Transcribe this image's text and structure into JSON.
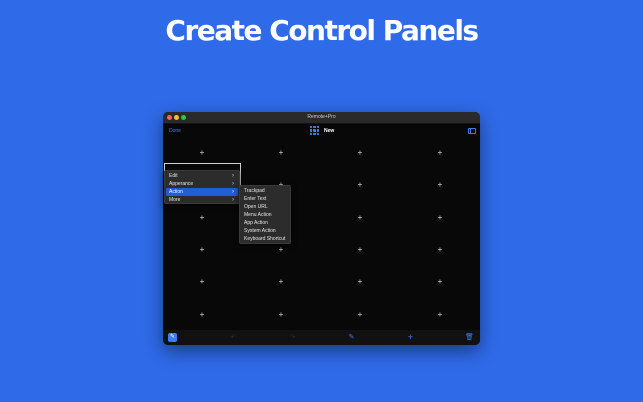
{
  "headline": "Create Control Panels",
  "window": {
    "title": "Remote+Pro",
    "toolbar": {
      "done_label": "Done",
      "panel_name": "New"
    }
  },
  "context_menu": {
    "items": [
      {
        "label": "Edit",
        "has_submenu": true
      },
      {
        "label": "Apperance",
        "has_submenu": true
      },
      {
        "label": "Action",
        "has_submenu": true,
        "selected": true
      },
      {
        "label": "More",
        "has_submenu": true
      }
    ]
  },
  "submenu": {
    "items": [
      {
        "label": "Trackpad"
      },
      {
        "label": "Enter Text"
      },
      {
        "label": "Open URL"
      },
      {
        "label": "Menu Action"
      },
      {
        "label": "App Action"
      },
      {
        "label": "System Action"
      },
      {
        "label": "Keyboard Shortcut"
      }
    ]
  },
  "canvas": {
    "add_symbol": "+",
    "grid": {
      "columns": 4,
      "rows": 6
    }
  },
  "bottom_toolbar": {
    "icons": [
      "edit-mode-icon",
      "undo-icon",
      "redo-icon",
      "pencil-icon",
      "add-icon",
      "trash-icon"
    ],
    "accent_color": "#3d7cf5"
  },
  "colors": {
    "background": "#2f6ae8",
    "accent": "#3d7cf5",
    "selection": "#1f5ed6"
  }
}
